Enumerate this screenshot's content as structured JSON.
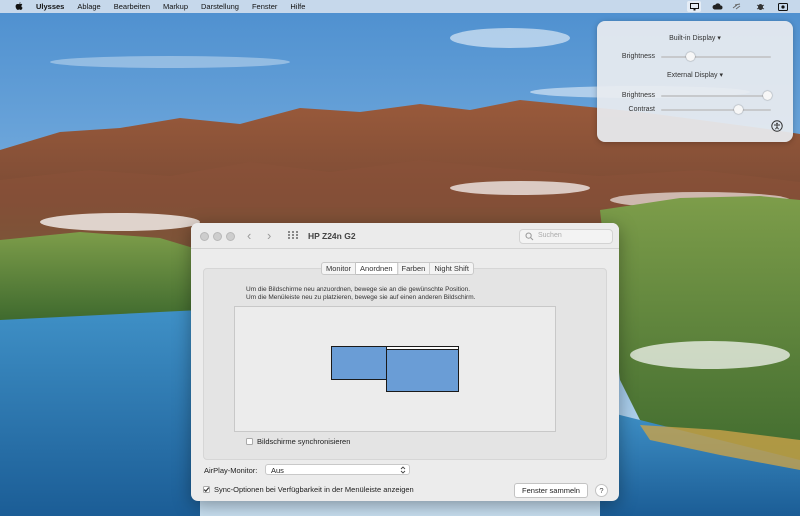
{
  "menubar": {
    "app_name": "Ulysses",
    "items": [
      "Ablage",
      "Bearbeiten",
      "Markup",
      "Darstellung",
      "Fenster",
      "Hilfe"
    ],
    "status_icons": [
      "display-icon",
      "cloud-icon",
      "sync-icon",
      "bug-icon",
      "screen-record-icon"
    ]
  },
  "popover": {
    "builtin_header": "Built-in Display ▾",
    "builtin_brightness_label": "Brightness",
    "builtin_brightness": 0.27,
    "external_header": "External Display ▾",
    "external_brightness_label": "Brightness",
    "external_brightness": 0.97,
    "external_contrast_label": "Contrast",
    "external_contrast": 0.7
  },
  "window": {
    "title": "HP Z24n G2",
    "search_placeholder": "Suchen",
    "tabs": [
      {
        "label": "Monitor",
        "active": false
      },
      {
        "label": "Anordnen",
        "active": true
      },
      {
        "label": "Farben",
        "active": false
      },
      {
        "label": "Night Shift",
        "active": false
      }
    ],
    "instruction_1": "Um die Bildschirme neu anzuordnen, bewege sie an die gewünschte Position.",
    "instruction_2": "Um die Menüleiste neu zu platzieren, bewege sie auf einen anderen Bildschirm.",
    "mirror_label": "Bildschirme synchronisieren",
    "mirror_checked": false,
    "airplay_label": "AirPlay-Monitor:",
    "airplay_value": "Aus",
    "sync_label": "Sync-Optionen bei Verfügbarkeit in der Menüleiste anzeigen",
    "sync_checked": true,
    "gather_button": "Fenster sammeln",
    "help_button": "?",
    "colors": {
      "display_fill": "#6a9dd6"
    }
  }
}
